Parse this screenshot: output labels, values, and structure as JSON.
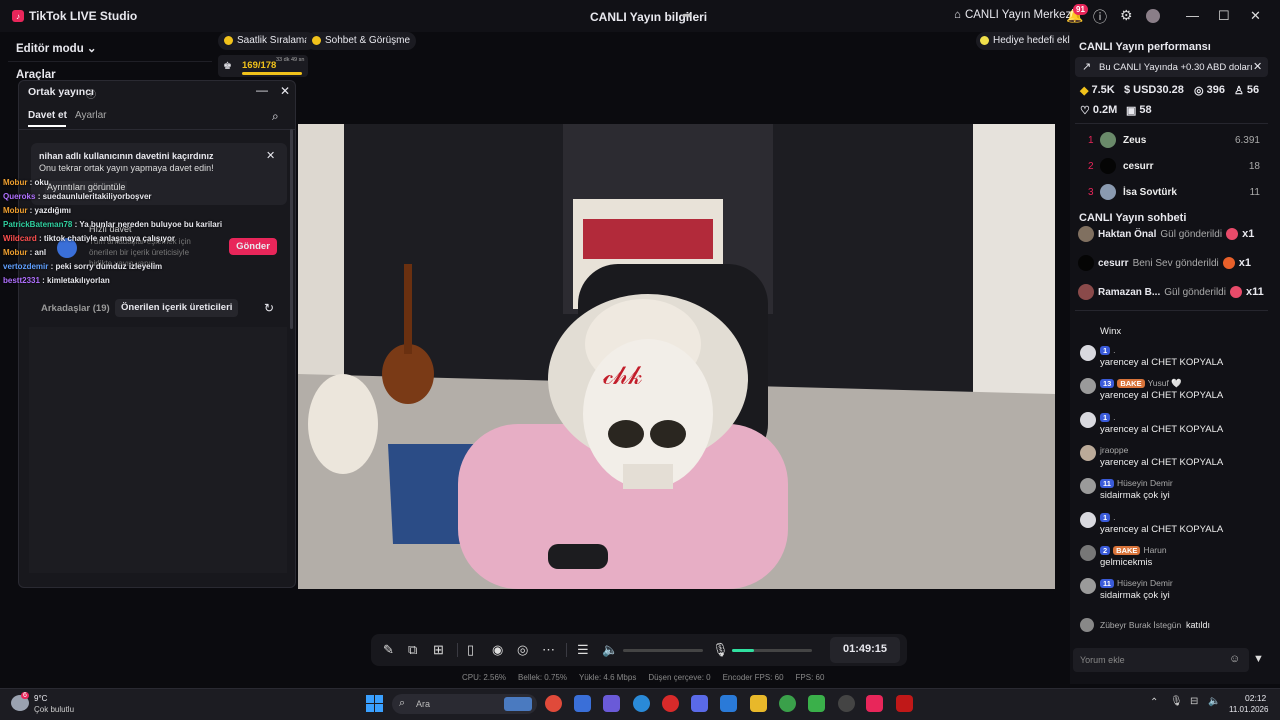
{
  "app": {
    "name": "TikTok LIVE Studio",
    "center_title": "CANLI Yayın bilgileri",
    "live_center": "CANLI Yayın Merkezi",
    "notif_count": "91"
  },
  "left": {
    "editor_mode": "Editör modu",
    "tools": "Araçlar"
  },
  "top_pills": {
    "hourly_rank": "Saatlik Sıralama",
    "chat_meet": "Sohbet & Görüşme",
    "gift_goal": "Hediye hedefi ekle"
  },
  "counter": {
    "value": "169/178",
    "time": "33 dk 49 sn"
  },
  "partner": {
    "title": "Ortak yayıncı",
    "tabs": [
      "Davet et",
      "Ayarlar"
    ],
    "missed_title": "nihan adlı kullanıcının davetini kaçırdınız",
    "missed_body": "Onu tekrar ortak yayın yapmaya davet edin!",
    "details_link": "Ayrıntıları görüntüle",
    "quick_invite": "Hızlı davet",
    "quick_body": "Tüm arkadaşlar eşlemek için önerilen bir içerik üreticisiyle birlikte yayın yapın",
    "send": "Gönder",
    "friends_tab": "Arkadaşlar (19)",
    "suggested_tab": "Önerilen içerik üreticileri"
  },
  "chat_overlay": [
    {
      "user": "Mobur",
      "text": "oku",
      "color": "#f0a030"
    },
    {
      "user": "Queroks",
      "text": "suedaunluleritakiliyorboşver",
      "color": "#b070ff"
    },
    {
      "user": "Mobur",
      "text": "yazdığımı",
      "color": "#f0a030"
    },
    {
      "user": "PatrickBateman78",
      "text": "Ya bunlar nereden buluyoe bu karilari",
      "color": "#30d0a0"
    },
    {
      "user": "Wildcard",
      "text": "tiktok chatiyle anlaşmaya çalışıyor",
      "color": "#ff5050"
    },
    {
      "user": "Mobur",
      "text": "anl",
      "color": "#f0a030"
    },
    {
      "user": "vertozdemir",
      "text": "peki sorry dumduz izleyelim",
      "color": "#60a0ff"
    },
    {
      "user": "bestt2331",
      "text": "kimletakılıyorlan",
      "color": "#b070ff"
    }
  ],
  "performance": {
    "title": "CANLI Yayın performansı",
    "banner": "Bu CANLI Yayında +0.30 ABD doları",
    "diamonds": "7.5K",
    "usd": "USD30.28",
    "viewers": "396",
    "new_followers": "56",
    "likes": "0.2M",
    "gifters": "58"
  },
  "ranking": [
    {
      "rank": "1",
      "name": "Zeus",
      "score": "6.391"
    },
    {
      "rank": "2",
      "name": "cesurr",
      "score": "18"
    },
    {
      "rank": "3",
      "name": "İsa Sovtürk",
      "score": "11"
    }
  ],
  "chat": {
    "title": "CANLI Yayın sohbeti",
    "gifts": [
      {
        "name": "Haktan Önal",
        "text": "Gül gönderildi",
        "count": "x1"
      },
      {
        "name": "cesurr",
        "text": "Beni Sev gönderildi",
        "count": "x1"
      },
      {
        "name": "Ramazan B...",
        "text": "Gül gönderildi",
        "count": "x11"
      }
    ],
    "messages": [
      {
        "lvl": "",
        "name": "",
        "text": "Winx"
      },
      {
        "lvl": "1",
        "name": ".",
        "text": "yarencey al CHET KOPYALA"
      },
      {
        "lvl": "13",
        "bake": "BAKE",
        "name": "Yusuf 🤍",
        "text": "yarencey al CHET KOPYALA"
      },
      {
        "lvl": "1",
        "name": ".",
        "text": "yarencey al CHET KOPYALA"
      },
      {
        "lvl": "",
        "name": "jraoppe",
        "text": "yarencey al CHET KOPYALA"
      },
      {
        "lvl": "11",
        "name": "Hüseyin Demir",
        "text": "sidairmak çok iyi"
      },
      {
        "lvl": "1",
        "name": ".",
        "text": "yarencey al CHET KOPYALA"
      },
      {
        "lvl": "2",
        "bake": "BAKE",
        "name": "Harun",
        "text": "gelmicekmis"
      },
      {
        "lvl": "11",
        "name": "Hüseyin Demir",
        "text": "sidairmak çok iyi"
      }
    ],
    "join_name": "Zübeyr Burak İstegün",
    "join_text": "katıldı",
    "input_placeholder": "Yorum ekle"
  },
  "timer": "01:49:15",
  "stats": {
    "cpu": "CPU:  2.56%",
    "mem": "Bellek:  0.75%",
    "upload": "Yükle:  4.6 Mbps",
    "dropped": "Düşen çerçeve:  0",
    "enc_fps": "Encoder FPS:  60",
    "fps": "FPS:  60"
  },
  "taskbar": {
    "weather_temp": "9°C",
    "weather_desc": "Çok bulutlu",
    "search": "Ara",
    "time": "02:12",
    "date": "11.01.2026",
    "weather_badge": "6"
  }
}
